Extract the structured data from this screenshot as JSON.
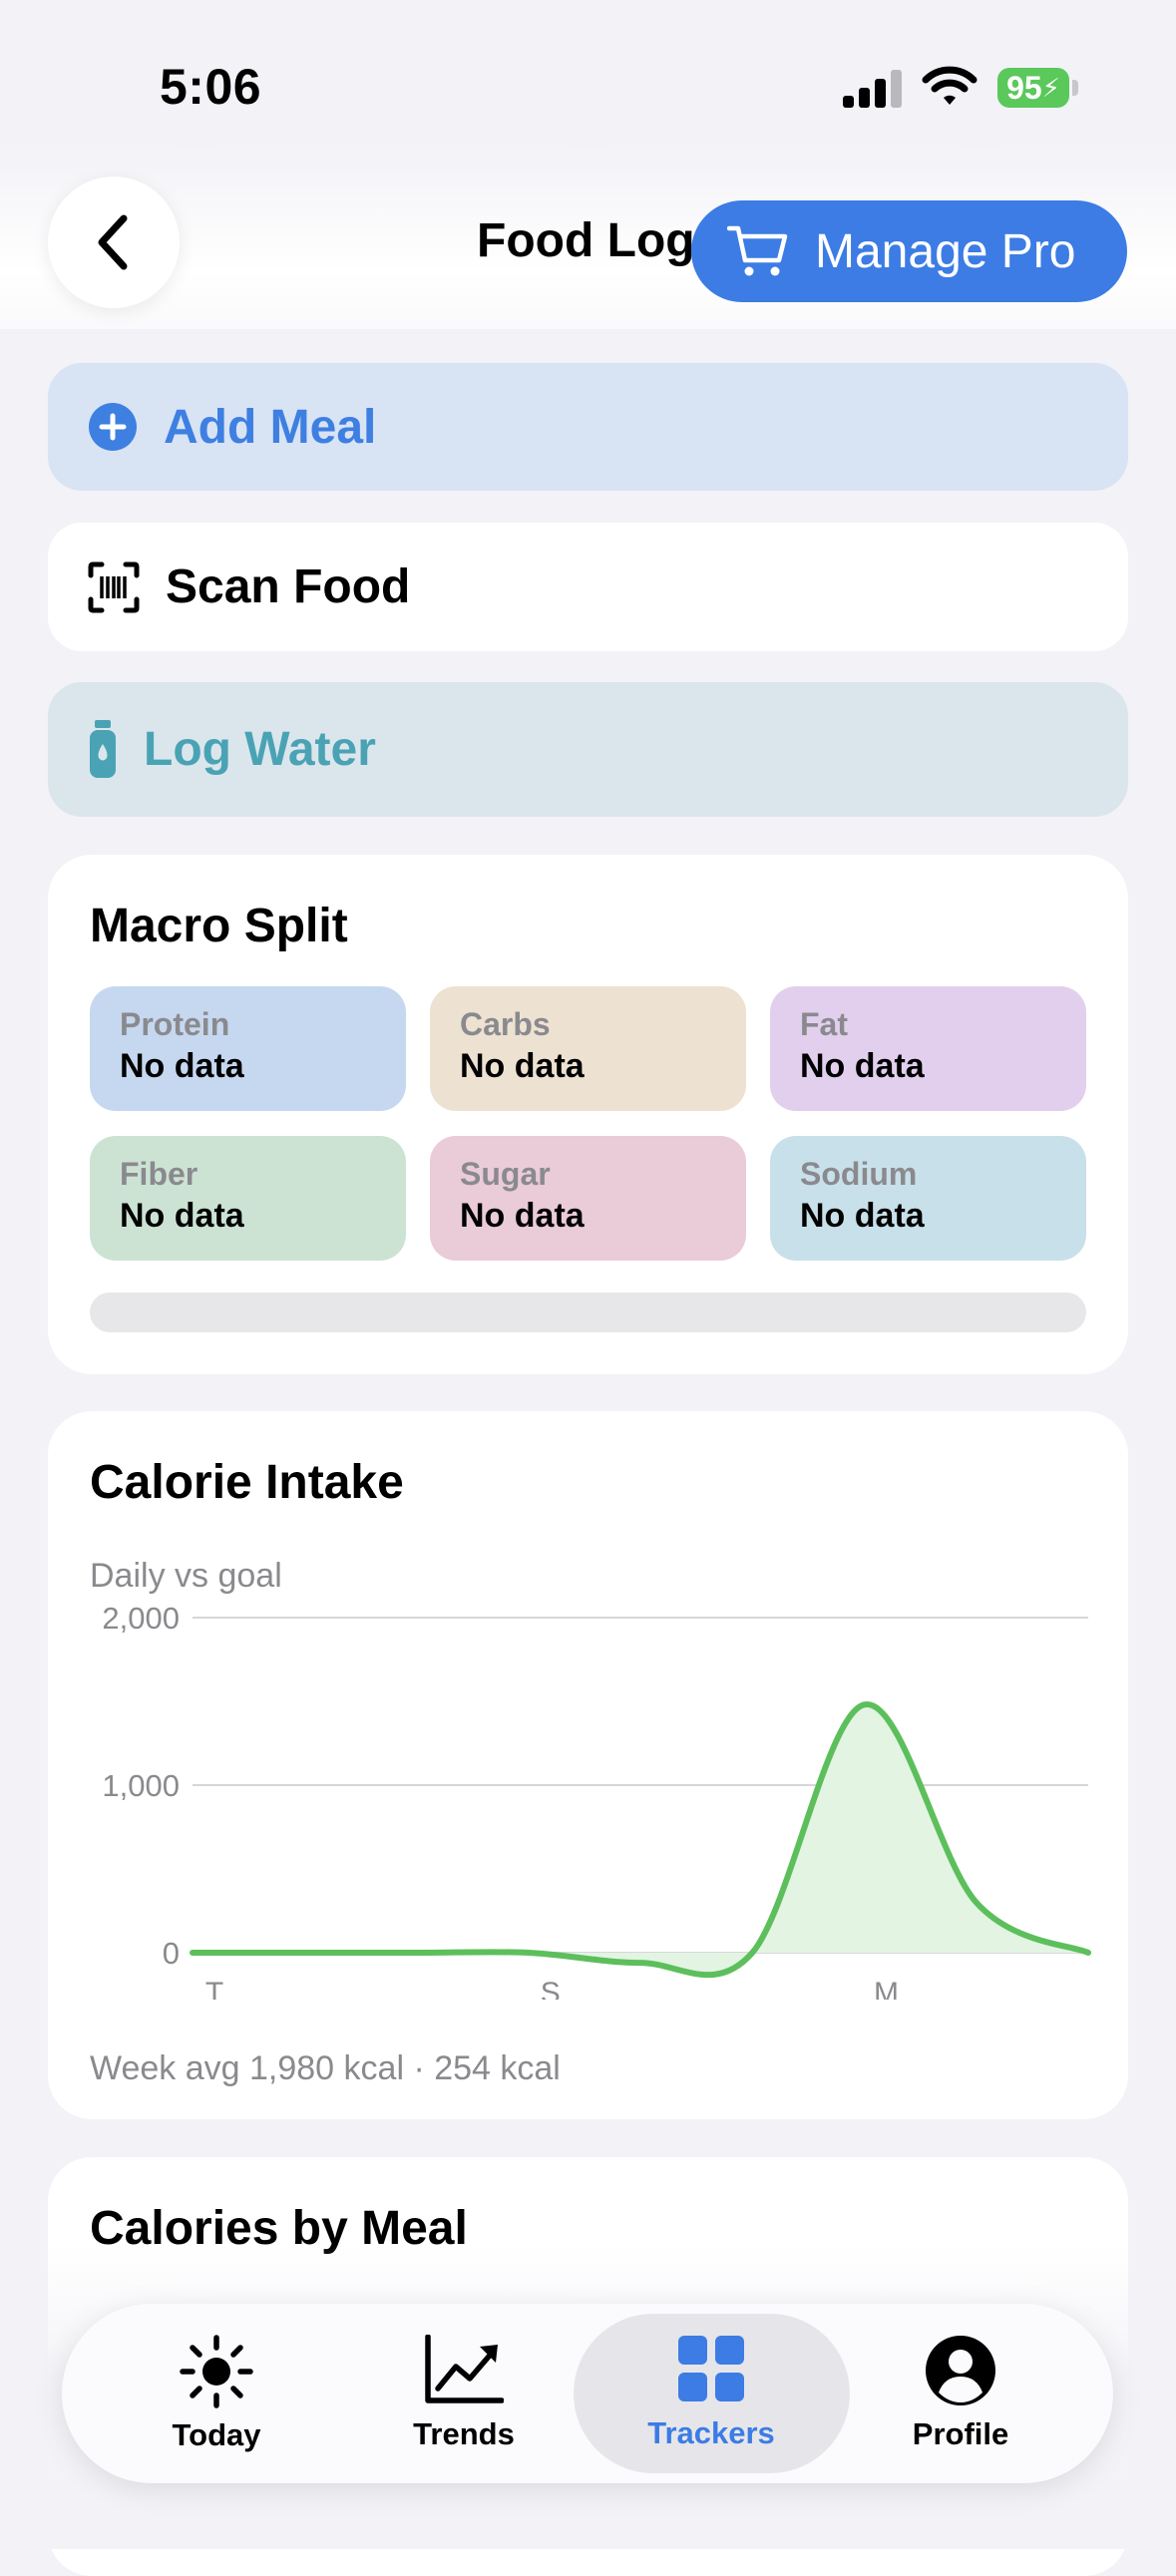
{
  "status_bar": {
    "time": "5:06",
    "battery": "95"
  },
  "header": {
    "title": "Food Log",
    "pro_button": "Manage Pro"
  },
  "actions": {
    "add_meal": "Add Meal",
    "scan_food": "Scan Food",
    "log_water": "Log Water"
  },
  "macro_split": {
    "title": "Macro Split",
    "items": [
      {
        "name": "Protein",
        "value": "No data",
        "color": "#c5d8ef"
      },
      {
        "name": "Carbs",
        "value": "No data",
        "color": "#ede1d2"
      },
      {
        "name": "Fat",
        "value": "No data",
        "color": "#e2cfee"
      },
      {
        "name": "Fiber",
        "value": "No data",
        "color": "#cce3d4"
      },
      {
        "name": "Sugar",
        "value": "No data",
        "color": "#eacbd8"
      },
      {
        "name": "Sodium",
        "value": "No data",
        "color": "#c8e0ea"
      }
    ]
  },
  "calorie_intake": {
    "title": "Calorie Intake",
    "subtitle": "Daily vs goal",
    "footer": "Week avg 1,980 kcal · 254 kcal"
  },
  "chart_data": {
    "type": "area",
    "x": [
      "T",
      "",
      "",
      "S",
      "",
      "",
      "M",
      "",
      ""
    ],
    "series": [
      {
        "values": [
          0,
          0,
          0,
          0,
          -60,
          0,
          1480,
          300,
          0
        ]
      }
    ],
    "xticks": [
      "T",
      "S",
      "M"
    ],
    "yticks": [
      "0",
      "1,000",
      "2,000"
    ],
    "ylim": [
      0,
      2000
    ],
    "grid": true,
    "colors": {
      "line": "#5cbf5c",
      "fill": "#e3f4e3"
    }
  },
  "calories_by_meal": {
    "title": "Calories by Meal"
  },
  "tab_bar": {
    "tabs": [
      {
        "label": "Today",
        "icon": "sun-icon"
      },
      {
        "label": "Trends",
        "icon": "trend-chart-icon"
      },
      {
        "label": "Trackers",
        "icon": "grid-icon"
      },
      {
        "label": "Profile",
        "icon": "person-circle-icon"
      }
    ],
    "active": "Trackers",
    "accent": "#3c7ce4"
  }
}
